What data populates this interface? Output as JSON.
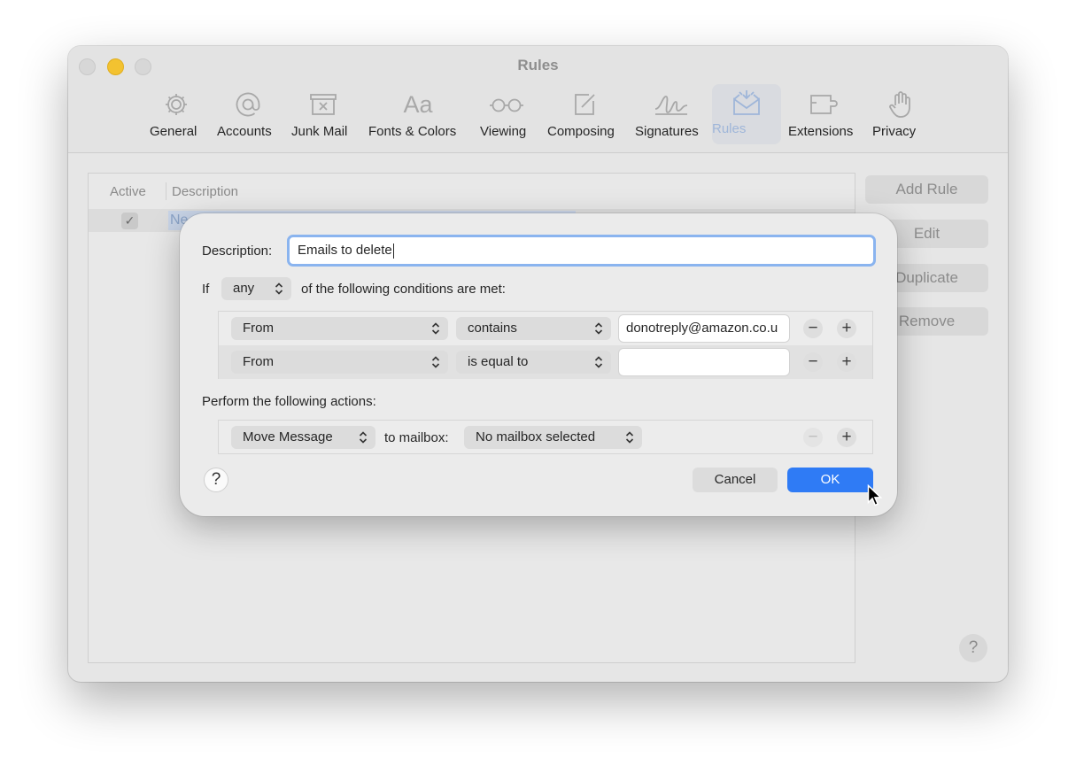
{
  "window": {
    "title": "Rules"
  },
  "toolbar": {
    "items": [
      {
        "label": "General",
        "icon": "gear-icon"
      },
      {
        "label": "Accounts",
        "icon": "at-icon"
      },
      {
        "label": "Junk Mail",
        "icon": "junk-mail-icon"
      },
      {
        "label": "Fonts & Colors",
        "icon": "fonts-icon"
      },
      {
        "label": "Viewing",
        "icon": "glasses-icon"
      },
      {
        "label": "Composing",
        "icon": "compose-icon"
      },
      {
        "label": "Signatures",
        "icon": "signature-icon"
      },
      {
        "label": "Rules",
        "icon": "rules-icon"
      },
      {
        "label": "Extensions",
        "icon": "extensions-icon"
      },
      {
        "label": "Privacy",
        "icon": "hand-icon"
      }
    ],
    "selected": "Rules",
    "accent_color": "#9fb6d9"
  },
  "rules_table": {
    "headers": [
      "Active",
      "Description"
    ],
    "rows": [
      {
        "active": "✓",
        "description": "Ne"
      }
    ]
  },
  "side_buttons": {
    "add_rule": "Add Rule",
    "edit": "Edit",
    "duplicate": "Duplicate",
    "remove": "Remove"
  },
  "window_help": "?",
  "dialog": {
    "description_label": "Description:",
    "description_value": "Emails to delete",
    "if_label": "If",
    "match_mode": "any",
    "conditions_suffix": "of the following conditions are met:",
    "conditions": [
      {
        "field": "From",
        "operator": "contains",
        "value": "donotreply@amazon.co.u"
      },
      {
        "field": "From",
        "operator": "is equal to",
        "value": ""
      }
    ],
    "actions_label": "Perform the following actions:",
    "actions": [
      {
        "action": "Move Message",
        "connector": "to mailbox:",
        "target": "No mailbox selected"
      }
    ],
    "help": "?",
    "cancel": "Cancel",
    "ok": "OK",
    "remove_symbol": "−",
    "add_symbol": "+",
    "ok_color": "#2f7bf5"
  }
}
